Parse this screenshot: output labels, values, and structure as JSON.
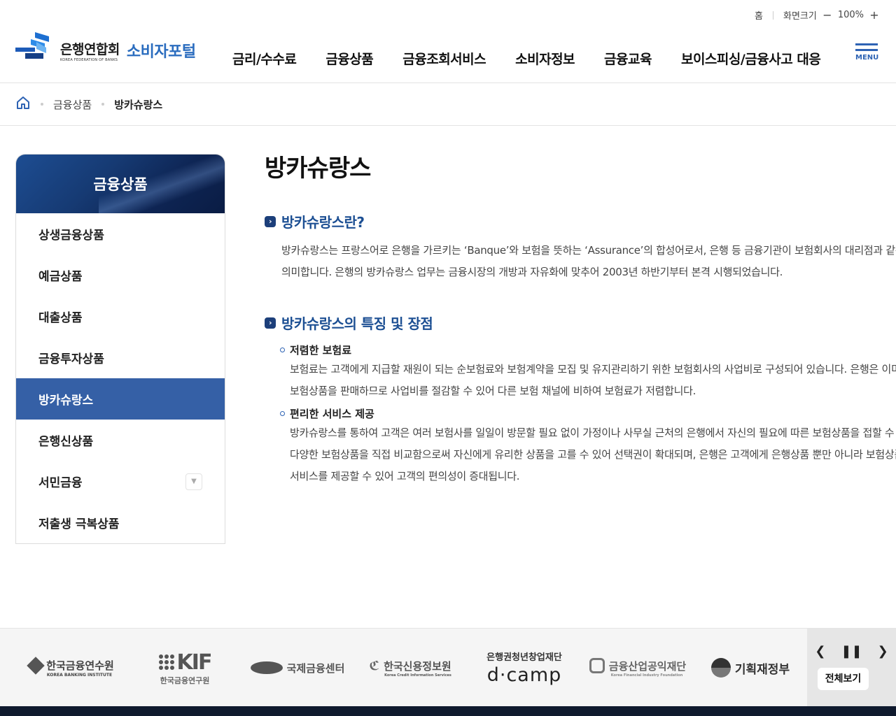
{
  "utility": {
    "home": "홈",
    "zoom_label": "화면크기",
    "zoom_value": "100%",
    "zoom_out": "−",
    "zoom_in": "+"
  },
  "logo": {
    "org_ko": "은행연합회",
    "org_en": "KOREA FEDERATION OF BANKS",
    "portal": "소비자포털"
  },
  "gnb": [
    "금리/수수료",
    "금융상품",
    "금융조회서비스",
    "소비자정보",
    "금융교육",
    "보이스피싱/금융사고 대응"
  ],
  "menu_label": "MENU",
  "breadcrumb": {
    "level1": "금융상품",
    "current": "방카슈랑스"
  },
  "lnb": {
    "title": "금융상품",
    "items": [
      "상생금융상품",
      "예금상품",
      "대출상품",
      "금융투자상품",
      "방카슈랑스",
      "은행신상품",
      "서민금융",
      "저출생 극복상품"
    ]
  },
  "content": {
    "title": "방카슈랑스",
    "section1": {
      "title": "방카슈랑스란?",
      "line1": "방카슈랑스는 프랑스어로 은행을 가르키는 ‘Banque’와 보험을 뜻하는 ‘Assurance’의 합성어로서, 은행 등 금융기관이 보험회사의 대리점과 같은 역",
      "line2": "의미합니다. 은행의 방카슈랑스 업무는 금융시장의 개방과 자유화에 맞추어 2003년 하반기부터 본격 시행되었습니다."
    },
    "section2": {
      "title": "방카슈랑스의 특징 및 장점",
      "item1": {
        "head": "저렴한 보험료",
        "line1": "보험료는 고객에게 지급할 재원이 되는 순보험료와 보험계약을 모집 및 유지관리하기 위한 보험회사의 사업비로 구성되어 있습니다. 은행은 이미 구",
        "line2": "보험상품을 판매하므로 사업비를 절감할 수 있어 다른 보험 채널에 비하여 보험료가 저렴합니다."
      },
      "item2": {
        "head": "편리한 서비스 제공",
        "line1": "방카슈랑스를 통하여 고객은 여러 보험사를 일일이 방문할 필요 없이 가정이나 사무실 근처의 은행에서 자신의 필요에 따른 보험상품을 접할 수 있",
        "line2": "다양한 보험상품을 직접 비교함으로써 자신에게 유리한 상품을 고를 수 있어 선택권이 확대되며, 은행은 고객에게 은행상품 뿐만 아니라 보험상품",
        "line3": "서비스를 제공할 수 있어 고객의 편의성이 증대됩니다."
      }
    }
  },
  "partners": {
    "kbi_ko": "한국금융연수원",
    "kbi_en": "KOREA BANKING INSTITUTE",
    "kif_en": "KIF",
    "kif_ko": "한국금융연구원",
    "ifc": "국제금융센터",
    "kcis_ko": "한국신용정보원",
    "kcis_en": "Korea Credit Information Services",
    "dcamp_top": "은행권청년창업재단",
    "dcamp": "d·camp",
    "kfif_ko": "금융산업공익재단",
    "kfif_en": "Korea Financial Industry Foundation",
    "mof": "기획재정부",
    "view_all": "전체보기"
  }
}
